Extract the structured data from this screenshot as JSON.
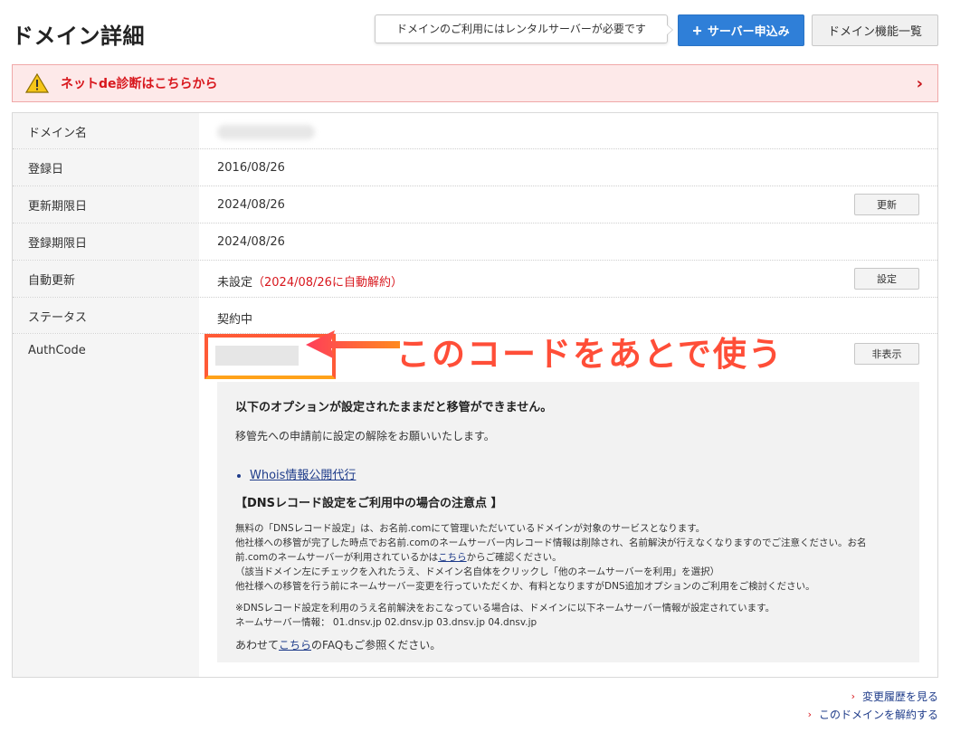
{
  "header": {
    "title": "ドメイン詳細",
    "tooltip": "ドメインのご利用にはレンタルサーバーが必要です",
    "apply_button": "サーバー申込み",
    "list_button": "ドメイン機能一覧"
  },
  "alert": {
    "text": "ネットde診断はこちらから",
    "chevron": "›"
  },
  "details": {
    "domain_label": "ドメイン名",
    "registered_label": "登録日",
    "registered_value": "2016/08/26",
    "renewal_label": "更新期限日",
    "renewal_value": "2024/08/26",
    "renewal_button": "更新",
    "expiry_label": "登録期限日",
    "expiry_value": "2024/08/26",
    "auto_label": "自動更新",
    "auto_value": "未設定",
    "auto_note": "（2024/08/26に自動解約）",
    "auto_button": "設定",
    "status_label": "ステータス",
    "status_value": "契約中",
    "auth_label": "AuthCode",
    "auth_button": "非表示"
  },
  "callout": "このコードをあとで使う",
  "notice": {
    "title": "以下のオプションが設定されたままだと移管ができません。",
    "sub": "移管先への申請前に設定の解除をお願いいたします。",
    "whois_link": "Whois情報公開代行",
    "dns_heading": "【DNSレコード設定をご利用中の場合の注意点 】",
    "p1": "無料の「DNSレコード設定」は、お名前.comにて管理いただいているドメインが対象のサービスとなります。",
    "p2": "他社様への移管が完了した時点でお名前.comのネームサーバー内レコード情報は削除され、名前解決が行えなくなりますのでご注意ください。お名",
    "p3a": "前.comのネームサーバーが利用されているかは",
    "p3_link": "こちら",
    "p3b": "からご確認ください。",
    "p4": "（該当ドメイン左にチェックを入れたうえ、ドメイン名自体をクリックし「他のネームサーバーを利用」を選択）",
    "p5": "他社様への移管を行う前にネームサーバー変更を行っていただくか、有料となりますがDNS追加オプションのご利用をご検討ください。",
    "p6": "※DNSレコード設定を利用のうえ名前解決をおこなっている場合は、ドメインに以下ネームサーバー情報が設定されています。",
    "p7": "ネームサーバー情報： 01.dnsv.jp 02.dnsv.jp 03.dnsv.jp 04.dnsv.jp",
    "faq_a": "あわせて",
    "faq_link": "こちら",
    "faq_b": "のFAQもご参照ください。"
  },
  "footer": {
    "history_link": "変更履歴を見る",
    "cancel_link": "このドメインを解約する"
  },
  "colors": {
    "primary": "#2f7fd8",
    "alert_red": "#d8171d",
    "callout": "#ff4e38"
  }
}
